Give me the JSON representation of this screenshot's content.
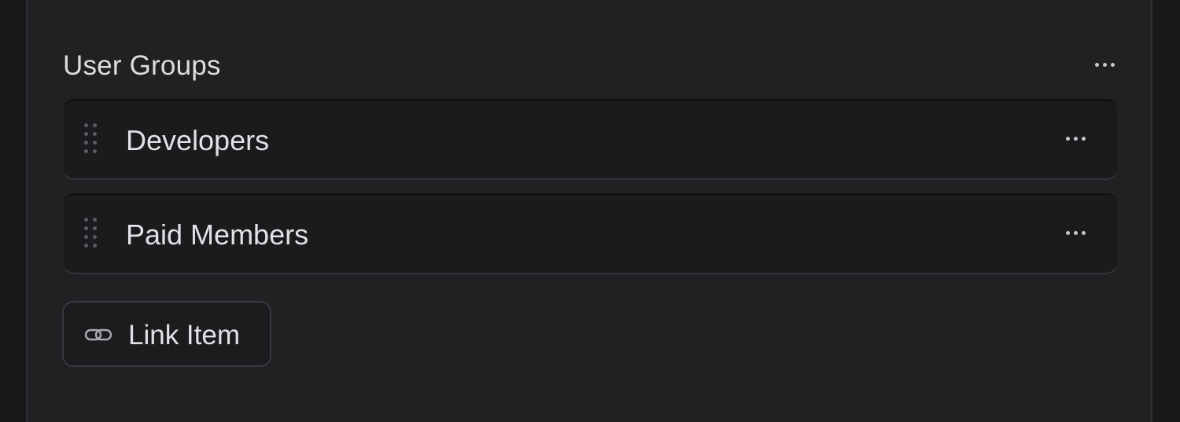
{
  "section": {
    "title": "User Groups"
  },
  "groups": [
    {
      "label": "Developers"
    },
    {
      "label": "Paid Members"
    }
  ],
  "link_button": {
    "label": "Link Item",
    "icon": "link-icon"
  },
  "icons": {
    "more": "more-horizontal-icon",
    "drag": "drag-handle-icon"
  },
  "colors": {
    "background": "#18181b",
    "panel": "#212124",
    "row": "#1b1b1e",
    "text": "#e2e2e6",
    "muted": "#5b5b62"
  }
}
